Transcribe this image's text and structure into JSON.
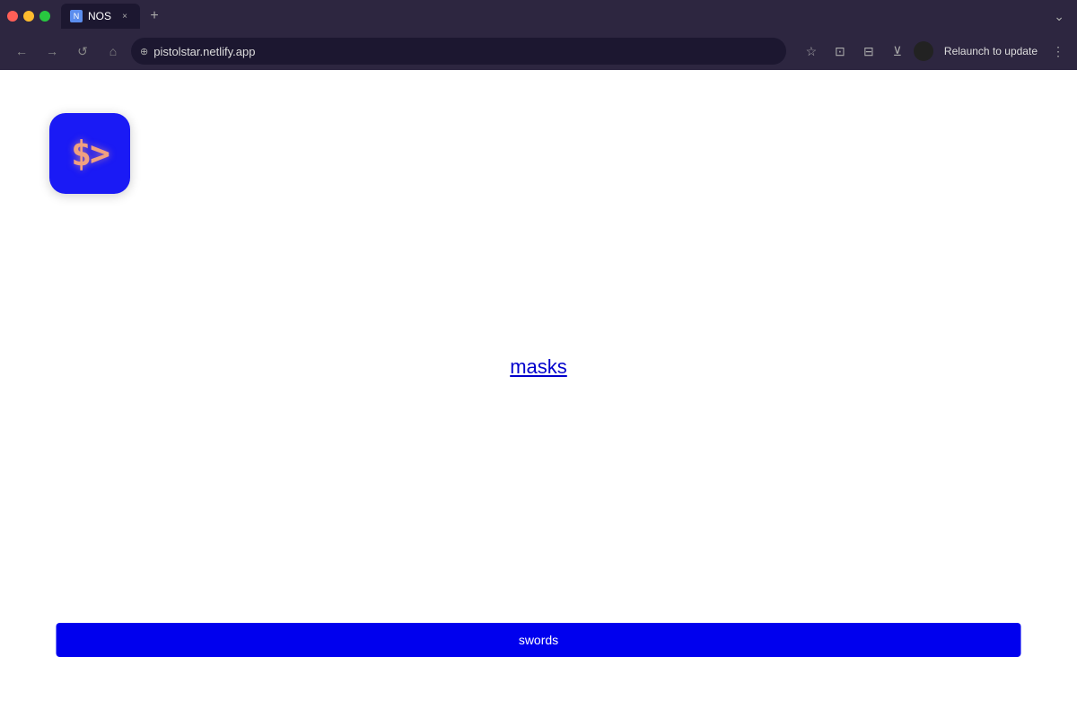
{
  "browser": {
    "tab": {
      "favicon_label": "N",
      "title": "NOS",
      "close_label": "×"
    },
    "tab_add_label": "+",
    "tab_chevron_label": "⌄",
    "nav": {
      "back_label": "←",
      "forward_label": "→",
      "reload_label": "↺",
      "home_label": "⌂"
    },
    "url": {
      "security_icon": "⊕",
      "value": "pistolstar.netlify.app"
    },
    "actions": {
      "bookmark_label": "☆",
      "extensions_label": "⊡",
      "cast_label": "⊟",
      "download_label": "⊻",
      "menu_label": "⋮"
    },
    "relaunch_label": "Relaunch to update"
  },
  "page": {
    "logo": {
      "text": "$>"
    },
    "center_link": {
      "text": "masks"
    },
    "input": {
      "value": "swords",
      "placeholder": "swords"
    }
  }
}
